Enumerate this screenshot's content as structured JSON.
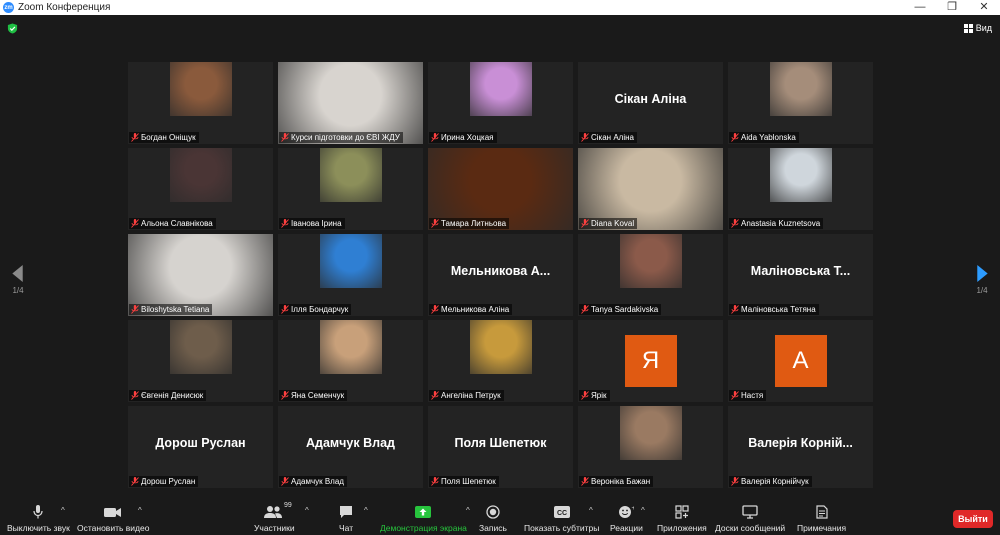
{
  "window": {
    "title": "Zoom Конференция",
    "controls": [
      "—",
      "❐",
      "✕"
    ]
  },
  "view_label": "Вид",
  "pagination": {
    "left": "1/4",
    "right": "1/4"
  },
  "participants": [
    {
      "name": "Богдан Оніщук",
      "kind": "photo",
      "tint": "#8a5a3c"
    },
    {
      "name": "Курси підготовки до ЄВІ ЖДУ",
      "kind": "full",
      "tint": "#d8d4cf"
    },
    {
      "name": "Ирина Хоцкая",
      "kind": "photo",
      "tint": "#c98fd6"
    },
    {
      "name": "Сікан Аліна",
      "kind": "text",
      "big": "Сікан Аліна"
    },
    {
      "name": "Aida Yablonska",
      "kind": "photo",
      "tint": "#a58d7a"
    },
    {
      "name": "Альона Славнікова",
      "kind": "photo",
      "tint": "#4a3535"
    },
    {
      "name": "Іванова Ірина",
      "kind": "photo",
      "tint": "#8c8f5a"
    },
    {
      "name": "Тамара Литньова",
      "kind": "full",
      "tint": "#5a2a12",
      "active": true
    },
    {
      "name": "Diana Koval",
      "kind": "full",
      "tint": "#c9b9a2"
    },
    {
      "name": "Anastasia Kuznetsova",
      "kind": "photo",
      "tint": "#cfd6dc"
    },
    {
      "name": "Biloshytska Tetiana",
      "kind": "full",
      "tint": "#d6d3cf"
    },
    {
      "name": "Ілля Бондарчук",
      "kind": "photo",
      "tint": "#2f7fd3"
    },
    {
      "name": "Мельникова Аліна",
      "kind": "text",
      "big": "Мельникова А..."
    },
    {
      "name": "Tanya Sardakivska",
      "kind": "photo",
      "tint": "#8b5a4a"
    },
    {
      "name": "Маліновська Тетяна",
      "kind": "text",
      "big": "Маліновська Т..."
    },
    {
      "name": "Євгенія Денисюк",
      "kind": "photo",
      "tint": "#6e5d4b"
    },
    {
      "name": "Яна Семенчук",
      "kind": "photo",
      "tint": "#c8a07a"
    },
    {
      "name": "Ангеліна Петрук",
      "kind": "photo",
      "tint": "#c79a3c"
    },
    {
      "name": "Ярік",
      "kind": "avatar",
      "letter": "Я"
    },
    {
      "name": "Настя",
      "kind": "avatar",
      "letter": "A"
    },
    {
      "name": "Дорош Руслан",
      "kind": "text",
      "big": "Дорош Руслан"
    },
    {
      "name": "Адамчук Влад",
      "kind": "text",
      "big": "Адамчук Влад"
    },
    {
      "name": "Поля Шепетюк",
      "kind": "text",
      "big": "Поля Шепетюк"
    },
    {
      "name": "Вероніка Бажан",
      "kind": "photo",
      "tint": "#9a7a62"
    },
    {
      "name": "Валерія Корнійчук",
      "kind": "text",
      "big": "Валерія Корній..."
    }
  ],
  "toolbar": {
    "mute": "Выключить звук",
    "video": "Остановить видео",
    "participants": "Участники",
    "participants_count": "99",
    "chat": "Чат",
    "share": "Демонстрация экрана",
    "record": "Запись",
    "captions": "Показать субтитры",
    "reactions": "Реакции",
    "apps": "Приложения",
    "whiteboard": "Доски сообщений",
    "notes": "Примечания",
    "leave": "Выйти",
    "captions_icon_text": "CC"
  },
  "colors": {
    "accent_green": "#27c43d",
    "active_speaker": "#b9e02a",
    "leave_red": "#e02828",
    "avatar_orange": "#e05a12",
    "next_arrow": "#2d9cff"
  }
}
